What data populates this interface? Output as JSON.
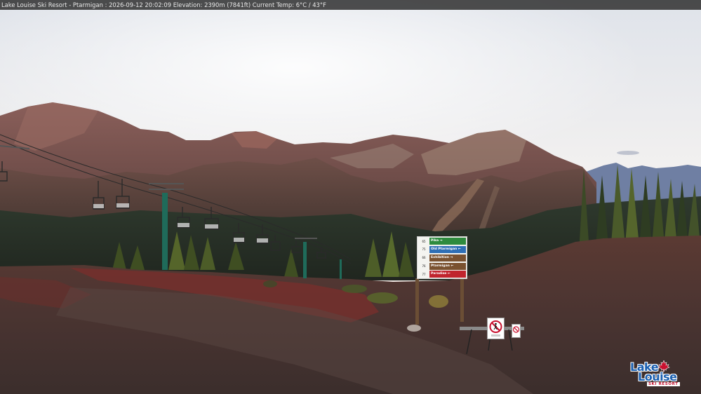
{
  "overlay": {
    "caption": "Lake Louise Ski Resort - Ptarmigan : 2026-09-12 20:02:09  Elevation: 2390m (7841ft) Current Temp: 6°C / 43°F"
  },
  "trail_sign": {
    "rows": [
      {
        "level": "65",
        "name": "Pika",
        "color": "#2e8b3e",
        "arrow": "→"
      },
      {
        "level": "75",
        "name": "Old Ptarmigan",
        "color": "#2f6fb5",
        "arrow": "←"
      },
      {
        "level": "66",
        "name": "Exhibition",
        "color": "#7a5230",
        "arrow": "→"
      },
      {
        "level": "76",
        "name": "Ptarmigan",
        "color": "#7a5230",
        "arrow": "←"
      },
      {
        "level": "77",
        "name": "Paradise",
        "color": "#c0242e",
        "arrow": "←"
      }
    ]
  },
  "logo": {
    "line1": "Lake",
    "line2": "Louise",
    "tagline": "SKI RESORT",
    "brand_blue": "#1a5fb0",
    "brand_red": "#c8102e"
  }
}
